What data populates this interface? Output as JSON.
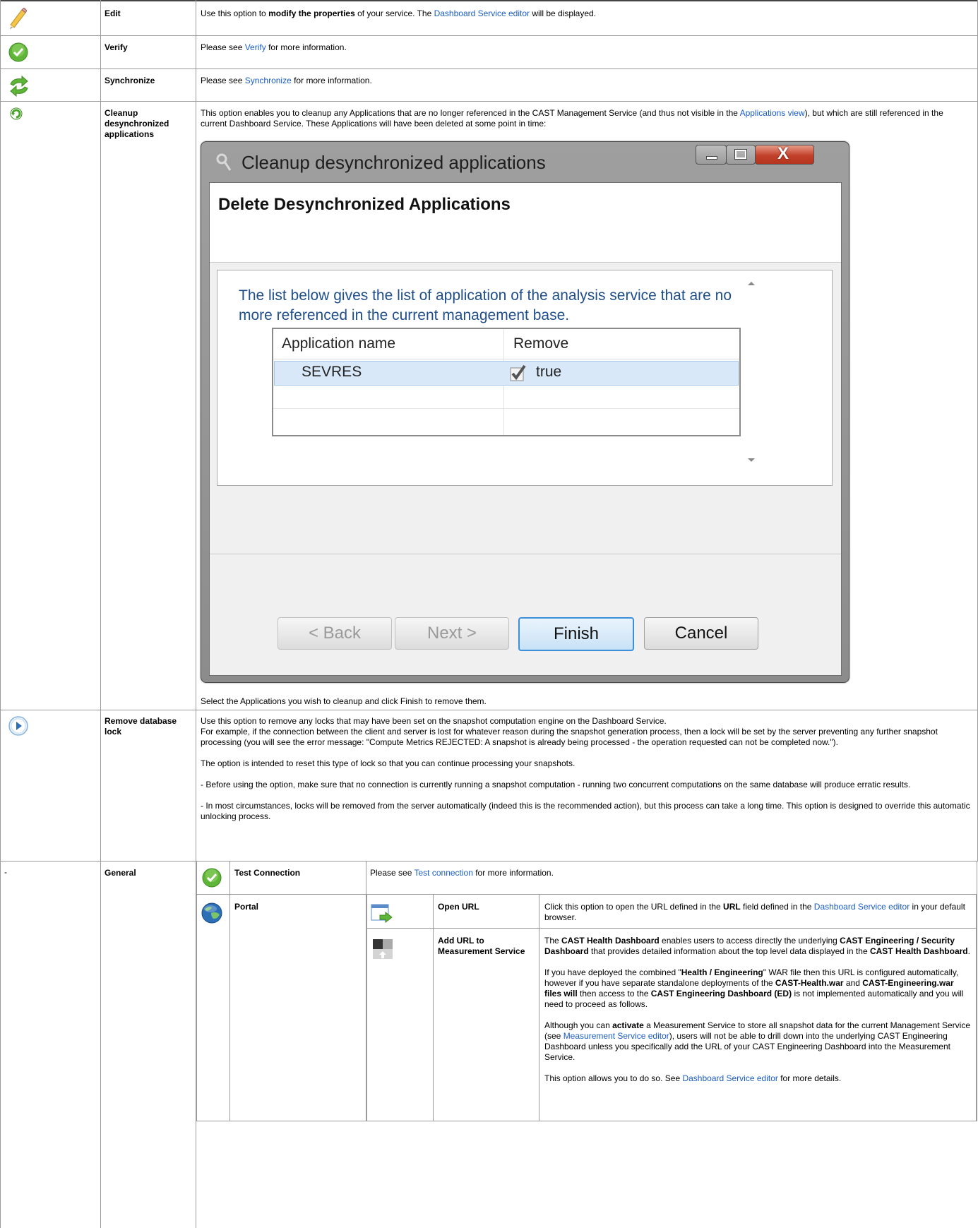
{
  "rows": {
    "edit": {
      "label": "Edit",
      "desc_pre": "Use this option to ",
      "desc_bold": "modify the properties",
      "desc_mid": " of your service. The ",
      "desc_link": "Dashboard Service editor",
      "desc_post": " will be displayed."
    },
    "verify": {
      "label": "Verify",
      "desc_pre": "Please see ",
      "desc_link": "Verify",
      "desc_post": " for more information."
    },
    "synchronize": {
      "label": "Synchronize",
      "desc_pre": "Please see ",
      "desc_link": "Synchronize",
      "desc_post": " for more information."
    },
    "cleanup": {
      "label": "Cleanup desynchronized applications",
      "desc_pre": "This option enables you to cleanup any Applications that are no longer referenced in the CAST Management Service (and thus not visible in the ",
      "desc_link": "Applications view",
      "desc_post": "), but which are still referenced in the current Dashboard Service. These Applications will have been deleted at some point in time:",
      "after": "Select the Applications you wish to cleanup and click Finish to remove them."
    },
    "remove_lock": {
      "label": "Remove database lock",
      "p1": "Use this option to remove any locks that may have been set on the snapshot computation engine on the Dashboard Service.",
      "p2": "For example, if the connection between the client and server is lost for whatever reason during the snapshot generation process, then a lock will be set by the server preventing any further snapshot processing (you will see the error message: \"Compute Metrics REJECTED: A snapshot is already being processed - the operation requested can not be completed now.\").",
      "p3": "The option is intended to reset this type of lock so that you can continue processing your snapshots.",
      "p4": "- Before using the option, make sure that no connection is currently running a snapshot computation - running two concurrent computations on the same database will produce erratic results.",
      "p5": "- In most circumstances, locks will be removed from the server automatically (indeed this is the recommended action), but this process can take a long time. This option is designed to override this automatic unlocking process."
    },
    "general": {
      "icon_text": "-",
      "label": "General",
      "test_connection": {
        "label": "Test Connection",
        "desc_pre": "Please see ",
        "desc_link": "Test connection",
        "desc_post": " for more information."
      },
      "portal": {
        "label": "Portal",
        "open_url": {
          "label": "Open URL",
          "desc_pre": "Click this option to open the URL defined in the ",
          "desc_bold": "URL",
          "desc_mid": " field defined in the ",
          "desc_link": "Dashboard Service editor",
          "desc_post": " in your default browser."
        },
        "add_url": {
          "label": "Add URL to Measurement Service",
          "p1_a": "The ",
          "p1_b": "CAST Health Dashboard",
          "p1_c": " enables users to access directly the underlying ",
          "p1_d": "CAST Engineering / Security Dashboard",
          "p1_e": " that provides detailed information about the top level data displayed in the ",
          "p1_f": "CAST Health Dashboard",
          "p1_g": ".",
          "p2_a": "If you have deployed the combined \"",
          "p2_b": "Health / Engineering",
          "p2_c": "\" WAR file then this URL is configured automatically, however if you have separate standalone deployments of the ",
          "p2_d": "CAST-Health.war",
          "p2_e": " and ",
          "p2_f": "CAST-Engineering.war files will",
          "p2_g": " then access to the ",
          "p2_h": "CAST Engineering Dashboard (ED)",
          "p2_i": " is not implemented automatically and you will need to proceed as follows.",
          "p3_a": "Although you can ",
          "p3_b": "activate",
          "p3_c": " a Measurement Service to store all snapshot data for the current Management Service (see ",
          "p3_d": "Measurement Service editor",
          "p3_e": "), users will not be able to drill down into the underlying CAST Engineering Dashboard unless you specifically add the URL of your CAST Engineering Dashboard into the Measurement Service.",
          "p4_a": "This option allows you to do so. See ",
          "p4_b": "Dashboard Service editor",
          "p4_c": " for more details."
        }
      }
    }
  },
  "dialog": {
    "title": "Cleanup desynchronized applications",
    "heading": "Delete Desynchronized Applications",
    "description": "The list below gives the list of application of the analysis service that are no more referenced in the current management base.",
    "col_name": "Application name",
    "col_remove": "Remove",
    "app_name": "SEVRES",
    "app_remove": "true",
    "buttons": {
      "back": "< Back",
      "next": "Next >",
      "finish": "Finish",
      "cancel": "Cancel"
    }
  },
  "icons": [
    "pencil-icon",
    "check-circle-icon",
    "sync-arrows-icon",
    "refresh-small-icon",
    "arrow-circle-icon",
    "check-circle-icon",
    "globe-icon",
    "open-url-icon",
    "add-url-icon"
  ]
}
